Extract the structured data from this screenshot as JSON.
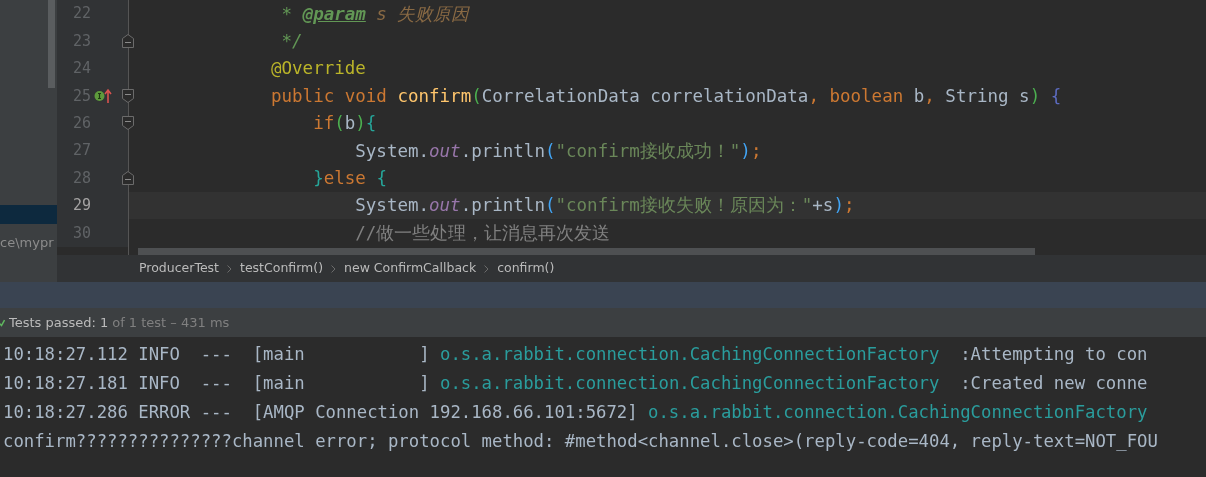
{
  "sidebar": {
    "rows": [
      {
        "selected": true
      },
      {
        "label": "ce\\mypr",
        "selected": false
      }
    ]
  },
  "editor": {
    "lines": [
      {
        "number": "22",
        "fold_start": false,
        "fold_end": false,
        "implements": false,
        "current": false,
        "tokens": [
          {
            "kind": "doc",
            "text": " * "
          },
          {
            "kind": "doc_tag",
            "text": "@param"
          },
          {
            "kind": "doc_text",
            "text": " s 失败原因"
          }
        ]
      },
      {
        "number": "23",
        "fold_start": false,
        "fold_end": true,
        "implements": false,
        "current": false,
        "tokens": [
          {
            "kind": "doc",
            "text": " */"
          }
        ]
      },
      {
        "number": "24",
        "fold_start": false,
        "fold_end": false,
        "implements": false,
        "current": false,
        "tokens": [
          {
            "kind": "annotation",
            "text": "@Override"
          }
        ]
      },
      {
        "number": "25",
        "fold_start": true,
        "fold_end": false,
        "implements": true,
        "current": false,
        "tokens": [
          {
            "kind": "keyword",
            "text": "public void "
          },
          {
            "kind": "method",
            "text": "confirm"
          },
          {
            "kind": "paren_green",
            "text": "("
          },
          {
            "kind": "plain",
            "text": "CorrelationData correlationData"
          },
          {
            "kind": "keyword",
            "text": ", boolean"
          },
          {
            "kind": "plain",
            "text": " b"
          },
          {
            "kind": "keyword",
            "text": ", "
          },
          {
            "kind": "plain",
            "text": "String s"
          },
          {
            "kind": "paren_green",
            "text": ")"
          },
          {
            "kind": "brace_indigo",
            "text": " {"
          }
        ]
      },
      {
        "number": "26",
        "fold_start": true,
        "fold_end": false,
        "implements": false,
        "current": false,
        "tokens": [
          {
            "kind": "keyword",
            "text": "    if"
          },
          {
            "kind": "paren_green",
            "text": "("
          },
          {
            "kind": "plain",
            "text": "b"
          },
          {
            "kind": "paren_green",
            "text": ")"
          },
          {
            "kind": "brace_teal",
            "text": "{"
          }
        ]
      },
      {
        "number": "27",
        "fold_start": false,
        "fold_end": false,
        "implements": false,
        "current": false,
        "tokens": [
          {
            "kind": "plain",
            "text": "        System."
          },
          {
            "kind": "static",
            "text": "out"
          },
          {
            "kind": "plain",
            "text": ".println"
          },
          {
            "kind": "paren_blue",
            "text": "("
          },
          {
            "kind": "string",
            "text": "\"confirm接收成功！\""
          },
          {
            "kind": "paren_blue",
            "text": ")"
          },
          {
            "kind": "keyword",
            "text": ";"
          }
        ]
      },
      {
        "number": "28",
        "fold_start": false,
        "fold_end": true,
        "implements": false,
        "current": false,
        "tokens": [
          {
            "kind": "brace_teal",
            "text": "    }"
          },
          {
            "kind": "keyword",
            "text": "else "
          },
          {
            "kind": "brace_teal",
            "text": "{"
          }
        ]
      },
      {
        "number": "29",
        "fold_start": false,
        "fold_end": false,
        "implements": false,
        "current": true,
        "tokens": [
          {
            "kind": "plain",
            "text": "        System."
          },
          {
            "kind": "static",
            "text": "out"
          },
          {
            "kind": "plain",
            "text": ".println"
          },
          {
            "kind": "paren_blue",
            "text": "("
          },
          {
            "kind": "string",
            "text": "\"confirm接收失败！原因为：\""
          },
          {
            "kind": "plain",
            "text": "+s"
          },
          {
            "kind": "paren_blue",
            "text": ")"
          },
          {
            "kind": "keyword",
            "text": ";"
          }
        ]
      },
      {
        "number": "30",
        "fold_start": false,
        "fold_end": false,
        "implements": false,
        "current": false,
        "tokens": [
          {
            "kind": "comment",
            "text": "        //做一些处理，让消息再次发送"
          }
        ]
      }
    ]
  },
  "breadcrumbs": [
    "ProducerTest",
    "testConfirm()",
    "new ConfirmCallback",
    "confirm()"
  ],
  "test_status": {
    "label": "Tests passed:",
    "count": "1",
    "summary": "of 1 test – 431 ms",
    "passed": true
  },
  "console": {
    "lines": [
      {
        "tokens": [
          {
            "kind": "plain",
            "text": "10:18:27.112 INFO  ---  [main           ] "
          },
          {
            "kind": "logger",
            "text": "o.s.a.rabbit.connection.CachingConnectionFactory"
          },
          {
            "kind": "plain",
            "text": "  :Attempting to con"
          }
        ]
      },
      {
        "tokens": [
          {
            "kind": "plain",
            "text": "10:18:27.181 INFO  ---  [main           ] "
          },
          {
            "kind": "logger",
            "text": "o.s.a.rabbit.connection.CachingConnectionFactory"
          },
          {
            "kind": "plain",
            "text": "  :Created new conne"
          }
        ]
      },
      {
        "tokens": [
          {
            "kind": "plain",
            "text": "10:18:27.286 ERROR ---  [AMQP Connection 192.168.66.101:5672] "
          },
          {
            "kind": "logger",
            "text": "o.s.a.rabbit.connection.CachingConnectionFactory"
          }
        ]
      },
      {
        "tokens": [
          {
            "kind": "plain",
            "text": "confirm???????????????channel error; protocol method: #method<channel.close>(reply-code=404, reply-text=NOT_FOU"
          }
        ]
      }
    ]
  }
}
